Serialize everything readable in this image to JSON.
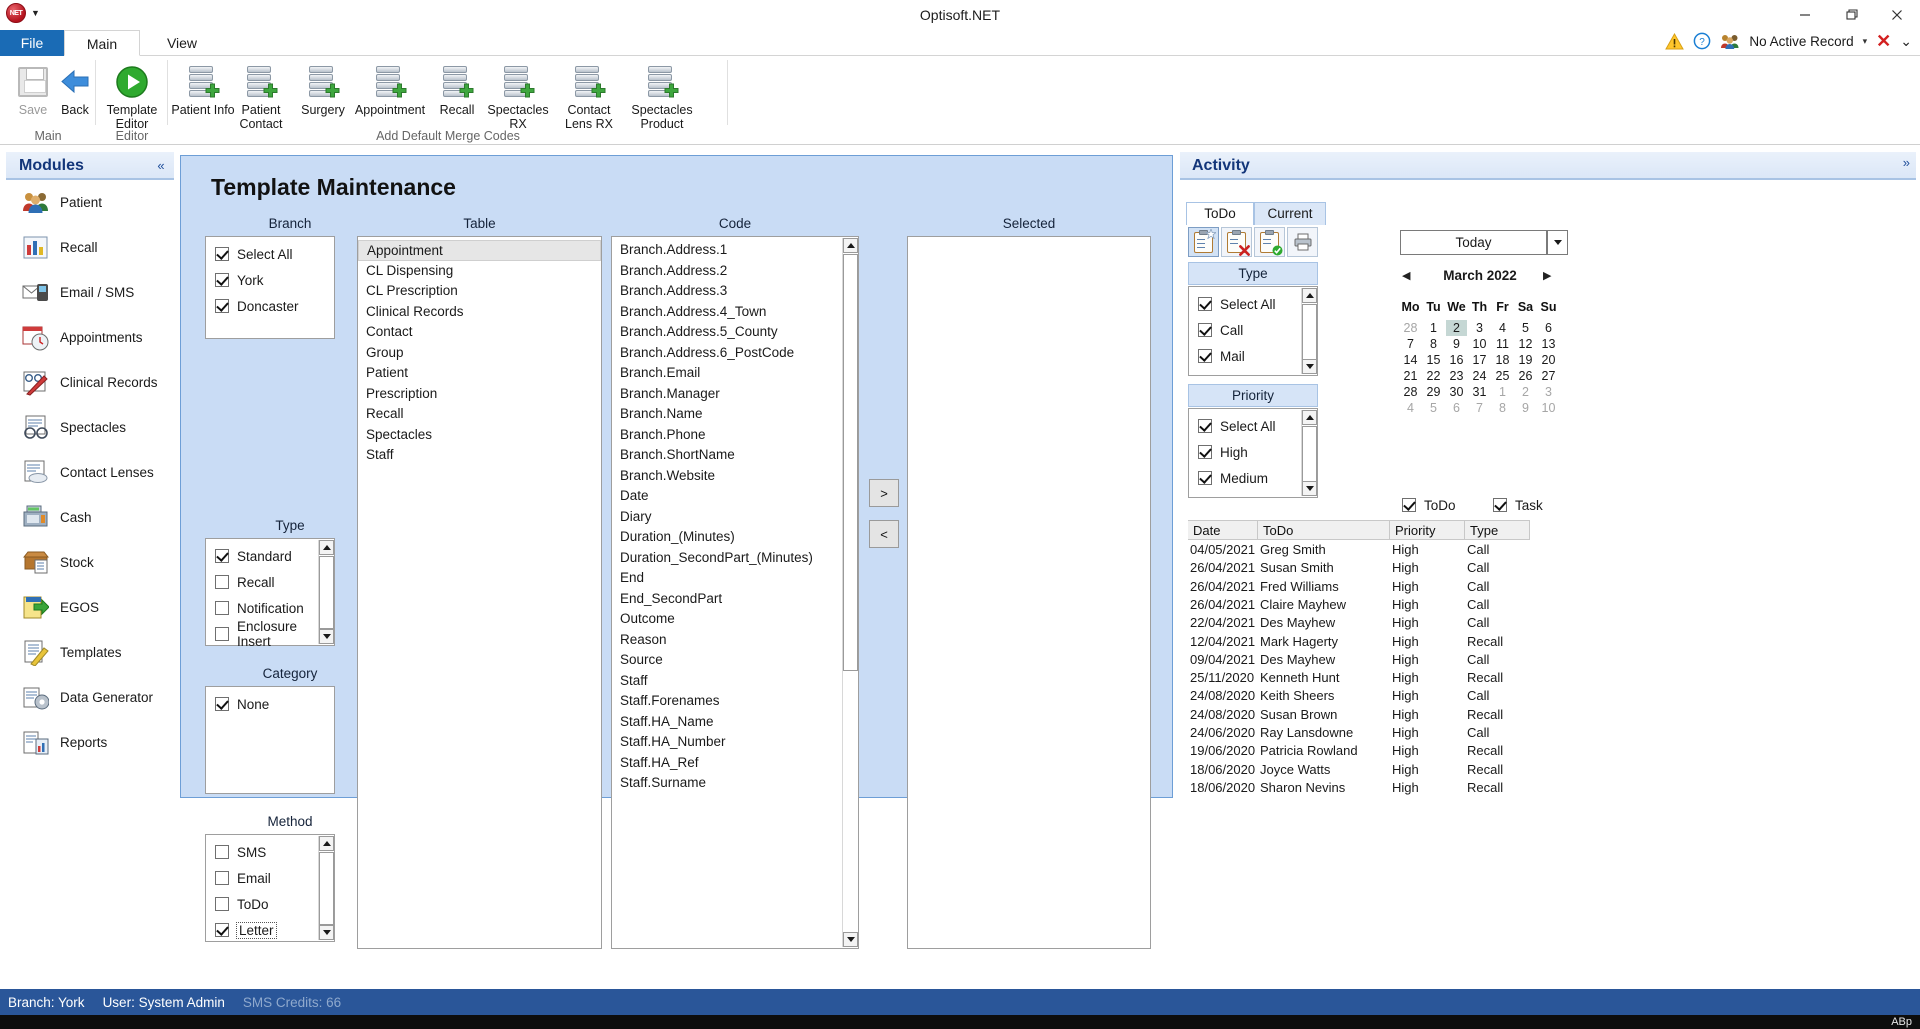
{
  "window": {
    "title": "Optisoft.NET",
    "quick_access": {
      "logo": "net-orb-icon",
      "caret": "customize-quick-access-icon"
    },
    "buttons": {
      "minimize": "minimize-icon",
      "maximize": "maximize-icon",
      "close": "close-icon"
    }
  },
  "ribbon": {
    "tabs": [
      {
        "label": "File",
        "active": false
      },
      {
        "label": "Main",
        "active": true
      },
      {
        "label": "View",
        "active": false
      }
    ],
    "right_status": {
      "warning_icon": "warning-triangle-icon",
      "help_icon": "help-circle-icon",
      "record_icon": "people-icon",
      "record_label": "No Active Record",
      "cancel_icon": "red-x-icon",
      "collapse_icon": "chevron-down-icon"
    },
    "groups": [
      {
        "label": "Main",
        "buttons": [
          {
            "label": "Save",
            "icon": "save-icon",
            "disabled": true
          },
          {
            "label": "Back",
            "icon": "back-arrow-icon",
            "disabled": false
          }
        ]
      },
      {
        "label": "Editor",
        "buttons": [
          {
            "label": "Template Editor",
            "icon": "play-circle-icon",
            "disabled": false
          }
        ]
      },
      {
        "label": "Add Default Merge Codes",
        "buttons": [
          {
            "label": "Patient Info",
            "icon": "database-add-icon"
          },
          {
            "label": "Patient Contact",
            "icon": "database-add-icon"
          },
          {
            "label": "Surgery",
            "icon": "database-add-icon"
          },
          {
            "label": "Appointment",
            "icon": "database-add-icon"
          },
          {
            "label": "Recall",
            "icon": "database-add-icon"
          },
          {
            "label": "Spectacles RX",
            "icon": "database-add-icon"
          },
          {
            "label": "Contact Lens RX",
            "icon": "database-add-icon"
          },
          {
            "label": "Spectacles Product",
            "icon": "database-add-icon"
          }
        ]
      }
    ]
  },
  "modules": {
    "title": "Modules",
    "collapse_icon": "collapse-left-icon",
    "items": [
      {
        "label": "Patient",
        "icon": "patients-icon"
      },
      {
        "label": "Recall",
        "icon": "bar-chart-icon"
      },
      {
        "label": "Email / SMS",
        "icon": "email-sms-icon"
      },
      {
        "label": "Appointments",
        "icon": "calendar-clock-icon"
      },
      {
        "label": "Clinical Records",
        "icon": "clinical-records-icon"
      },
      {
        "label": "Spectacles",
        "icon": "spectacles-icon"
      },
      {
        "label": "Contact Lenses",
        "icon": "contact-lenses-icon"
      },
      {
        "label": "Cash",
        "icon": "cash-register-icon"
      },
      {
        "label": "Stock",
        "icon": "stock-box-icon"
      },
      {
        "label": "EGOS",
        "icon": "egos-icon"
      },
      {
        "label": "Templates",
        "icon": "template-pencil-icon"
      },
      {
        "label": "Data Generator",
        "icon": "data-generator-icon"
      },
      {
        "label": "Reports",
        "icon": "reports-icon"
      }
    ]
  },
  "main": {
    "title": "Template Maintenance",
    "columns": {
      "branch": "Branch",
      "table": "Table",
      "code": "Code",
      "selected": "Selected",
      "type": "Type",
      "category": "Category",
      "method": "Method"
    },
    "branch": [
      {
        "label": "Select All",
        "checked": true
      },
      {
        "label": "York",
        "checked": true
      },
      {
        "label": "Doncaster",
        "checked": true
      }
    ],
    "type": [
      {
        "label": "Standard",
        "checked": true
      },
      {
        "label": "Recall",
        "checked": false
      },
      {
        "label": "Notification",
        "checked": false
      },
      {
        "label": "Enclosure Insert",
        "checked": false
      }
    ],
    "category": [
      {
        "label": "None",
        "checked": true
      }
    ],
    "method": [
      {
        "label": "SMS",
        "checked": false,
        "focused": false
      },
      {
        "label": "Email",
        "checked": false,
        "focused": false
      },
      {
        "label": "ToDo",
        "checked": false,
        "focused": false
      },
      {
        "label": "Letter",
        "checked": true,
        "focused": true
      }
    ],
    "table_list": [
      {
        "label": "Appointment",
        "selected": true
      },
      {
        "label": "CL Dispensing",
        "selected": false
      },
      {
        "label": "CL Prescription",
        "selected": false
      },
      {
        "label": "Clinical Records",
        "selected": false
      },
      {
        "label": "Contact",
        "selected": false
      },
      {
        "label": "Group",
        "selected": false
      },
      {
        "label": "Patient",
        "selected": false
      },
      {
        "label": "Prescription",
        "selected": false
      },
      {
        "label": "Recall",
        "selected": false
      },
      {
        "label": "Spectacles",
        "selected": false
      },
      {
        "label": "Staff",
        "selected": false
      }
    ],
    "code_list": [
      "Branch.Address.1",
      "Branch.Address.2",
      "Branch.Address.3",
      "Branch.Address.4_Town",
      "Branch.Address.5_County",
      "Branch.Address.6_PostCode",
      "Branch.Email",
      "Branch.Manager",
      "Branch.Name",
      "Branch.Phone",
      "Branch.ShortName",
      "Branch.Website",
      "Date",
      "Diary",
      "Duration_(Minutes)",
      "Duration_SecondPart_(Minutes)",
      "End",
      "End_SecondPart",
      "Outcome",
      "Reason",
      "Source",
      "Staff",
      "Staff.Forenames",
      "Staff.HA_Name",
      "Staff.HA_Number",
      "Staff.HA_Ref",
      "Staff.Surname"
    ],
    "selected_list": [],
    "move_right_label": ">",
    "move_left_label": "<"
  },
  "activity": {
    "title": "Activity",
    "expand_icon": "expand-right-icon",
    "tabs": [
      {
        "label": "ToDo",
        "active": true
      },
      {
        "label": "Current",
        "active": false
      }
    ],
    "toolbar": [
      {
        "icon": "new-todo-icon",
        "active": true
      },
      {
        "icon": "delete-todo-icon",
        "active": false
      },
      {
        "icon": "complete-todo-icon",
        "active": false
      },
      {
        "icon": "print-icon",
        "active": false
      }
    ],
    "type_header": "Type",
    "type_filters": [
      {
        "label": "Select All",
        "checked": true
      },
      {
        "label": "Call",
        "checked": true
      },
      {
        "label": "Mail",
        "checked": true
      }
    ],
    "priority_header": "Priority",
    "priority_filters": [
      {
        "label": "Select All",
        "checked": true
      },
      {
        "label": "High",
        "checked": true
      },
      {
        "label": "Medium",
        "checked": true
      }
    ],
    "today_button": "Today",
    "today_dropdown_icon": "chevron-down-icon",
    "calendar": {
      "prev_icon": "prev-month-icon",
      "next_icon": "next-month-icon",
      "month_label": "March 2022",
      "dow": [
        "Mo",
        "Tu",
        "We",
        "Th",
        "Fr",
        "Sa",
        "Su"
      ],
      "weeks": [
        [
          {
            "d": "28",
            "dim": true
          },
          {
            "d": "1"
          },
          {
            "d": "2",
            "today": true
          },
          {
            "d": "3"
          },
          {
            "d": "4"
          },
          {
            "d": "5"
          },
          {
            "d": "6"
          }
        ],
        [
          {
            "d": "7"
          },
          {
            "d": "8"
          },
          {
            "d": "9"
          },
          {
            "d": "10"
          },
          {
            "d": "11"
          },
          {
            "d": "12"
          },
          {
            "d": "13"
          }
        ],
        [
          {
            "d": "14"
          },
          {
            "d": "15"
          },
          {
            "d": "16"
          },
          {
            "d": "17"
          },
          {
            "d": "18"
          },
          {
            "d": "19"
          },
          {
            "d": "20"
          }
        ],
        [
          {
            "d": "21"
          },
          {
            "d": "22"
          },
          {
            "d": "23"
          },
          {
            "d": "24"
          },
          {
            "d": "25"
          },
          {
            "d": "26"
          },
          {
            "d": "27"
          }
        ],
        [
          {
            "d": "28"
          },
          {
            "d": "29"
          },
          {
            "d": "30"
          },
          {
            "d": "31"
          },
          {
            "d": "1",
            "dim": true
          },
          {
            "d": "2",
            "dim": true
          },
          {
            "d": "3",
            "dim": true
          }
        ],
        [
          {
            "d": "4",
            "dim": true
          },
          {
            "d": "5",
            "dim": true
          },
          {
            "d": "6",
            "dim": true
          },
          {
            "d": "7",
            "dim": true
          },
          {
            "d": "8",
            "dim": true
          },
          {
            "d": "9",
            "dim": true
          },
          {
            "d": "10",
            "dim": true
          }
        ]
      ]
    },
    "view_toggles": [
      {
        "label": "ToDo",
        "checked": true
      },
      {
        "label": "Task",
        "checked": true
      }
    ],
    "grid_headers": [
      "Date",
      "ToDo",
      "Priority",
      "Type"
    ],
    "grid_rows": [
      [
        "04/05/2021",
        "Greg Smith",
        "High",
        "Call"
      ],
      [
        "26/04/2021",
        "Susan Smith",
        "High",
        "Call"
      ],
      [
        "26/04/2021",
        "Fred Williams",
        "High",
        "Call"
      ],
      [
        "26/04/2021",
        "Claire Mayhew",
        "High",
        "Call"
      ],
      [
        "22/04/2021",
        "Des Mayhew",
        "High",
        "Call"
      ],
      [
        "12/04/2021",
        "Mark Hagerty",
        "High",
        "Recall"
      ],
      [
        "09/04/2021",
        "Des Mayhew",
        "High",
        "Call"
      ],
      [
        "25/11/2020",
        "Kenneth Hunt",
        "High",
        "Recall"
      ],
      [
        "24/08/2020",
        "Keith Sheers",
        "High",
        "Call"
      ],
      [
        "24/08/2020",
        "Susan Brown",
        "High",
        "Recall"
      ],
      [
        "24/06/2020",
        "Ray Lansdowne",
        "High",
        "Call"
      ],
      [
        "19/06/2020",
        "Patricia Rowland",
        "High",
        "Recall"
      ],
      [
        "18/06/2020",
        "Joyce Watts",
        "High",
        "Recall"
      ],
      [
        "18/06/2020",
        "Sharon Nevins",
        "High",
        "Recall"
      ]
    ]
  },
  "statusbar": {
    "branch": "Branch: York",
    "user": "User: System Admin",
    "sms_credits": "SMS Credits: 66"
  }
}
